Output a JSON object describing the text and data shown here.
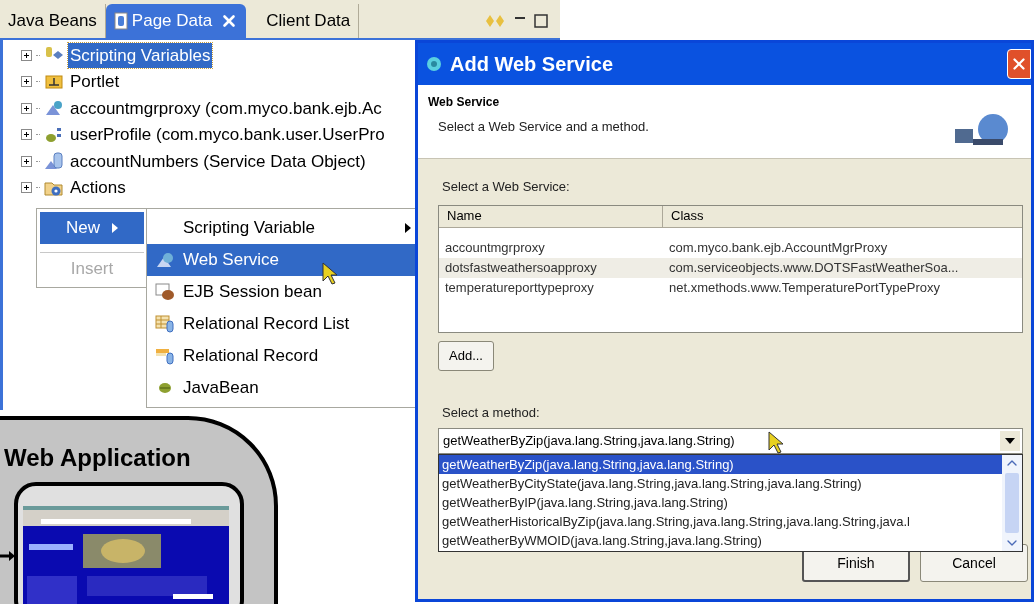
{
  "view": {
    "tabs": [
      {
        "label": "Java Beans",
        "selected": false,
        "closable": false
      },
      {
        "label": "Page Data",
        "selected": true,
        "closable": true
      },
      {
        "label": "Client Data",
        "selected": false,
        "closable": false
      }
    ],
    "tree": [
      {
        "label": "Scripting Variables",
        "selected": true
      },
      {
        "label": "Portlet",
        "selected": false
      },
      {
        "label": "accountmgrproxy (com.myco.bank.ejb.Ac",
        "selected": false
      },
      {
        "label": "userProfile (com.myco.bank.user.UserPro",
        "selected": false
      },
      {
        "label": "accountNumbers (Service Data Object)",
        "selected": false
      },
      {
        "label": "Actions",
        "selected": false
      }
    ],
    "context_menu": [
      {
        "label": "New",
        "selected": true,
        "disabled": false,
        "submenu": true
      },
      {
        "label": "Insert",
        "selected": false,
        "disabled": true,
        "submenu": false
      }
    ],
    "submenu": [
      {
        "label": "Scripting Variable",
        "selected": false,
        "submenu": true
      },
      {
        "label": "Web Service",
        "selected": true,
        "submenu": false
      },
      {
        "label": "EJB Session bean",
        "selected": false,
        "submenu": false
      },
      {
        "label": "Relational Record List",
        "selected": false,
        "submenu": false
      },
      {
        "label": "Relational Record",
        "selected": false,
        "submenu": false
      },
      {
        "label": "JavaBean",
        "selected": false,
        "submenu": false
      }
    ]
  },
  "diagram": {
    "title": "Web Application"
  },
  "dialog": {
    "title": "Add Web Service",
    "header_title": "Web Service",
    "header_description": "Select a Web Service and a method.",
    "service_label": "Select a Web Service:",
    "table": {
      "columns": [
        "Name",
        "Class"
      ],
      "rows": [
        {
          "name": "accountmgrproxy",
          "class": "com.myco.bank.ejb.AccountMgrProxy",
          "selected": false
        },
        {
          "name": "dotsfastweathersoapproxy",
          "class": "com.serviceobjects.www.DOTSFastWeatherSoa...",
          "selected": true
        },
        {
          "name": "temperatureporttypeproxy",
          "class": "net.xmethods.www.TemperaturePortTypeProxy",
          "selected": false
        }
      ]
    },
    "add_button": "Add...",
    "method_label": "Select a method:",
    "method_value": "getWeatherByZip(java.lang.String,java.lang.String)",
    "method_options": [
      {
        "label": "getWeatherByZip(java.lang.String,java.lang.String)",
        "selected": true
      },
      {
        "label": "getWeatherByCityState(java.lang.String,java.lang.String,java.lang.String)",
        "selected": false
      },
      {
        "label": "getWeatherByIP(java.lang.String,java.lang.String)",
        "selected": false
      },
      {
        "label": "getWeatherHistoricalByZip(java.lang.String,java.lang.String,java.lang.String,java.l",
        "selected": false
      },
      {
        "label": "getWeatherByWMOID(java.lang.String,java.lang.String)",
        "selected": false
      }
    ],
    "buttons": [
      "Finish",
      "Cancel"
    ]
  }
}
